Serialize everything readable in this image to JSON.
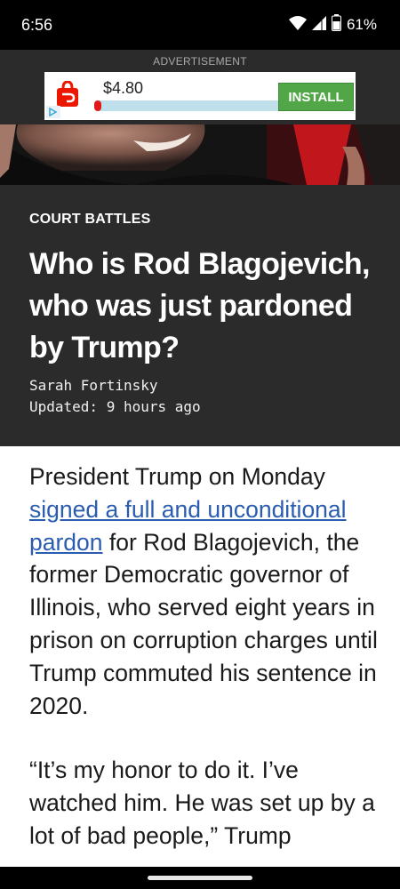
{
  "status_bar": {
    "time": "6:56",
    "battery_percent": "61%",
    "icons": [
      "wifi-icon",
      "signal-icon",
      "battery-icon"
    ]
  },
  "ad": {
    "label": "ADVERTISEMENT",
    "price": "$4.80",
    "progress_fraction": 0.03,
    "install_label": "INSTALL",
    "logo_icon": "doordash-bag-icon",
    "colors": {
      "logo": "#eb1700",
      "install": "#51a648",
      "track": "#bfe0ea",
      "fill": "#e01a1a"
    }
  },
  "article": {
    "section": "COURT BATTLES",
    "headline": "Who is Rod Blagojevich, who was just pardoned by Trump?",
    "author": "Sarah Fortinsky",
    "updated": "Updated: 9 hours ago",
    "paragraph1": {
      "before_link": "President Trump on Monday ",
      "link_text": "signed a full and unconditional pardon",
      "after_link": " for Rod Blagojevich, the former Democratic governor of Illinois, who served eight years in prison on corruption charges until Trump commuted his sentence in 2020."
    },
    "paragraph2": "“It’s my honor to do it. I’ve watched him. He was set up by a lot of bad people,” Trump"
  },
  "colors": {
    "header_bg": "#2b2b2b",
    "link": "#2a5db0"
  }
}
